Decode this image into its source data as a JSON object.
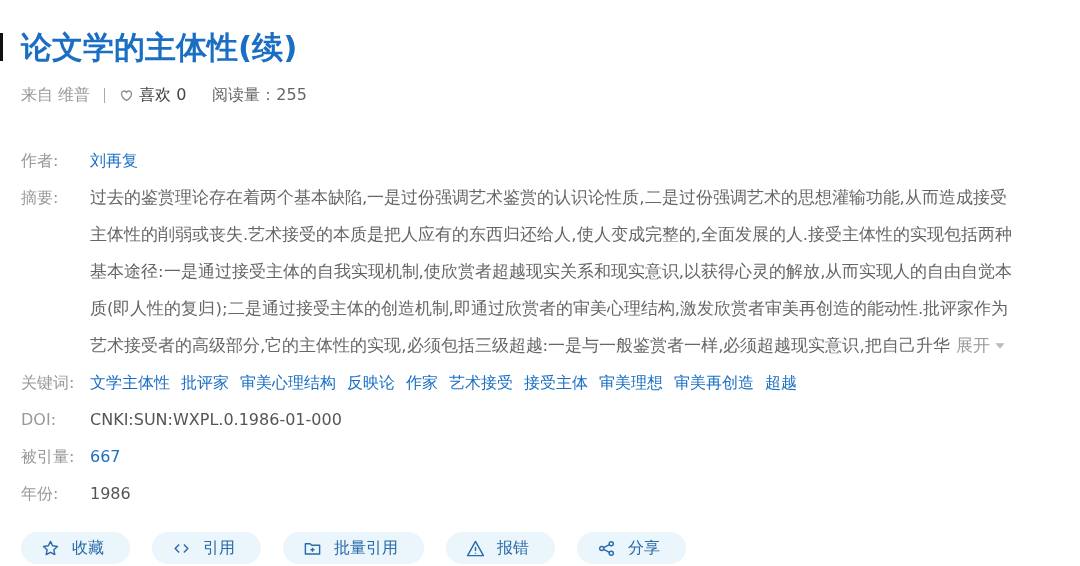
{
  "title": "论文学的主体性(续)",
  "meta": {
    "source": "来自 维普",
    "likes": "喜欢 0",
    "reads": "阅读量：255"
  },
  "fields": [
    {
      "kind": "link",
      "label": "作者:",
      "value": "刘再复"
    },
    {
      "kind": "abstract",
      "label": "摘要:",
      "value": "过去的鉴赏理论存在着两个基本缺陷,一是过份强调艺术鉴赏的认识论性质,二是过份强调艺术的思想灌输功能,从而造成接受主体性的削弱或丧失.艺术接受的本质是把人应有的东西归还给人,使人变成完整的,全面发展的人.接受主体性的实现包括两种基本途径:一是通过接受主体的自我实现机制,使欣赏者超越现实关系和现实意识,以获得心灵的解放,从而实现人的自由自觉本质(即人性的复归);二是通过接受主体的创造机制,即通过欣赏者的审美心理结构,激发欣赏者审美再创造的能动性.批评家作为艺术接受者的高级部分,它的主体性的实现,必须包括三级超越:一是与一般鉴赏者一样,必须超越现实意识,把自己升华",
      "toggle": "展开"
    },
    {
      "kind": "keywords",
      "label": "关键词:",
      "values": [
        "文学主体性",
        "批评家",
        "审美心理结构",
        "反映论",
        "作家",
        "艺术接受",
        "接受主体",
        "审美理想",
        "审美再创造",
        "超越"
      ]
    },
    {
      "kind": "text",
      "label": "DOI:",
      "value": "CNKI:SUN:WXPL.0.1986-01-000"
    },
    {
      "kind": "link",
      "label": "被引量:",
      "value": "667"
    },
    {
      "kind": "text",
      "label": "年份:",
      "value": "1986"
    }
  ],
  "actions": [
    {
      "kind": "favorite",
      "label": "收藏"
    },
    {
      "kind": "cite",
      "label": "引用"
    },
    {
      "kind": "batch",
      "label": "批量引用"
    },
    {
      "kind": "report",
      "label": "报错"
    },
    {
      "kind": "share",
      "label": "分享"
    }
  ]
}
